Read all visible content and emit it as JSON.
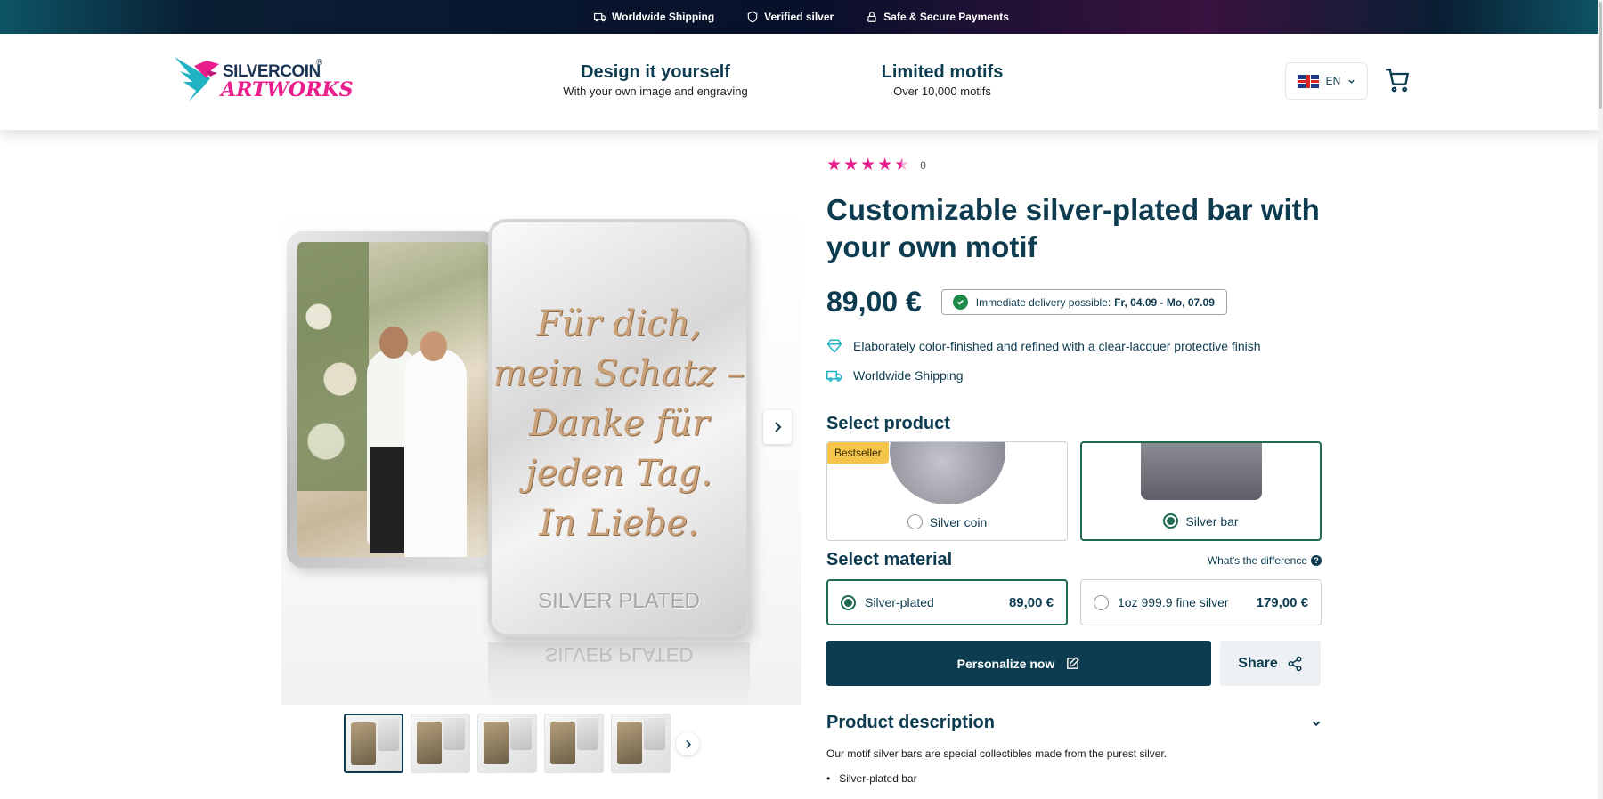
{
  "topbar": {
    "items": [
      {
        "label": "Worldwide Shipping",
        "icon": "truck-icon"
      },
      {
        "label": "Verified silver",
        "icon": "shield-icon"
      },
      {
        "label": "Safe & Secure Payments",
        "icon": "lock-icon"
      }
    ]
  },
  "header": {
    "logo_line1": "SILVERCOIN",
    "logo_line2": "ARTWORKS",
    "logo_reg": "®",
    "nav": [
      {
        "title": "Design it yourself",
        "subtitle": "With your own image and engraving"
      },
      {
        "title": "Limited motifs",
        "subtitle": "Over 10,000 motifs"
      }
    ],
    "language": "EN"
  },
  "gallery": {
    "engraving_lines": [
      "Für dich,",
      "mein Schatz –",
      "Danke für",
      "jeden Tag.",
      "In Liebe."
    ],
    "plated_label": "SILVER PLATED",
    "thumbnail_count": 5
  },
  "product": {
    "rating_count": "0",
    "rating_stars": 4.5,
    "title": "Customizable silver-plated bar with your own motif",
    "price": "89,00 €",
    "delivery_text": "Immediate delivery possible:",
    "delivery_dates": "Fr, 04.09 - Mo, 07.09",
    "features": [
      {
        "icon": "diamond-icon",
        "text": "Elaborately color-finished and refined with a clear-lacquer protective finish"
      },
      {
        "icon": "truck-icon",
        "text": "Worldwide Shipping"
      }
    ],
    "select_product_title": "Select product",
    "bestseller_badge": "Bestseller",
    "options": [
      {
        "label": "Silver coin",
        "selected": false
      },
      {
        "label": "Silver bar",
        "selected": true
      }
    ],
    "select_material_title": "Select material",
    "difference_link": "What's the difference",
    "materials": [
      {
        "label": "Silver-plated",
        "price": "89,00 €",
        "selected": true
      },
      {
        "label": "1oz 999.9 fine silver",
        "price": "179,00 €",
        "selected": false
      }
    ],
    "personalize_label": "Personalize now",
    "share_label": "Share",
    "description_title": "Product description",
    "description_text": "Our motif silver bars are special collectibles made from the purest silver.",
    "bullets": [
      "Silver-plated bar"
    ]
  },
  "colors": {
    "primary": "#0d3b4f",
    "accent": "#e91e8c",
    "selected": "#1e6b4f",
    "badge": "#f4c54a"
  }
}
